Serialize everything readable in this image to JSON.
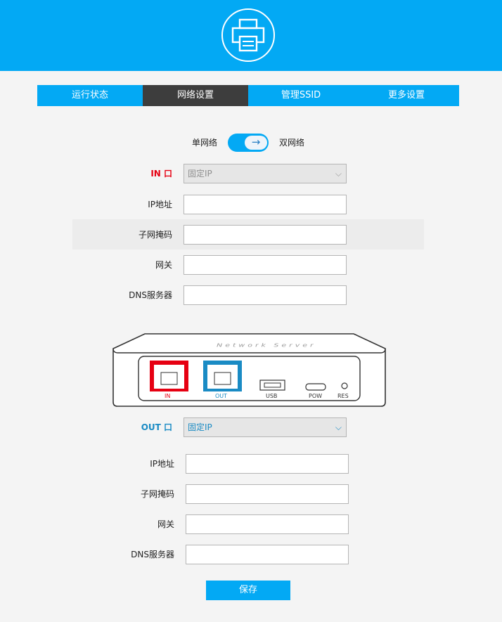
{
  "header": {
    "logo_icon": "printer-icon"
  },
  "tabs": [
    {
      "label": "运行状态",
      "active": false
    },
    {
      "label": "网络设置",
      "active": true
    },
    {
      "label": "管理SSID",
      "active": false
    },
    {
      "label": "更多设置",
      "active": false
    }
  ],
  "network_mode": {
    "left_label": "单网络",
    "right_label": "双网络",
    "knob_icon": "arrow-right-icon"
  },
  "in_port": {
    "label": "IN 口",
    "mode_value": "固定IP",
    "fields": {
      "ip": "IP地址",
      "mask": "子网掩码",
      "gateway": "网关",
      "dns": "DNS服务器"
    }
  },
  "device": {
    "brand_text": "Network Server",
    "ports": {
      "in": "IN",
      "out": "OUT",
      "usb": "USB",
      "pow": "POW",
      "res": "RES"
    }
  },
  "out_port": {
    "label": "OUT 口",
    "mode_value": "固定IP",
    "fields": {
      "ip": "IP地址",
      "mask": "子网掩码",
      "gateway": "网关",
      "dns": "DNS服务器"
    }
  },
  "save_label": "保存",
  "colors": {
    "accent": "#03a9f4",
    "tab_active": "#3d3d3d",
    "in_red": "#e60012",
    "out_blue": "#1a8bc4"
  }
}
